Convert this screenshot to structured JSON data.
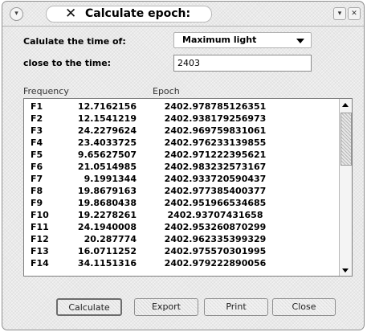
{
  "window": {
    "title": "Calculate epoch:",
    "title_icon": "x-mark-icon",
    "left_button_icon": "menu-circle-icon",
    "right_buttons": [
      "maximize-icon",
      "close-icon"
    ]
  },
  "form": {
    "calc_label": "Calulate the time of:",
    "calc_value": "Maximum light",
    "close_label": "close to the time:",
    "close_value": "2403"
  },
  "table": {
    "headers": [
      "Frequency",
      "Epoch"
    ],
    "rows": [
      {
        "f": "F1",
        "freq": "12.7162156",
        "epoch": "2402.978785126351"
      },
      {
        "f": "F2",
        "freq": "12.1541219",
        "epoch": "2402.938179256973"
      },
      {
        "f": "F3",
        "freq": "24.2279624",
        "epoch": "2402.969759831061"
      },
      {
        "f": "F4",
        "freq": "23.4033725",
        "epoch": "2402.976233139855"
      },
      {
        "f": "F5",
        "freq": "9.65627507",
        "epoch": "2402.971222395621"
      },
      {
        "f": "F6",
        "freq": "21.0514985",
        "epoch": "2402.983232573167"
      },
      {
        "f": "F7",
        "freq": "9.1991344",
        "epoch": "2402.933720590437"
      },
      {
        "f": "F8",
        "freq": "19.8679163",
        "epoch": "2402.977385400377"
      },
      {
        "f": "F9",
        "freq": "19.8680438",
        "epoch": "2402.951966534685"
      },
      {
        "f": "F10",
        "freq": "19.2278261",
        "epoch": "2402.93707431658"
      },
      {
        "f": "F11",
        "freq": "24.1940008",
        "epoch": "2402.953260870299"
      },
      {
        "f": "F12",
        "freq": "20.287774",
        "epoch": "2402.962335399329"
      },
      {
        "f": "F13",
        "freq": "16.0711252",
        "epoch": "2402.975570301995"
      },
      {
        "f": "F14",
        "freq": "34.1151316",
        "epoch": "2402.979222890056"
      }
    ]
  },
  "buttons": {
    "calculate": "Calculate",
    "export": "Export",
    "print": "Print",
    "close": "Close"
  }
}
